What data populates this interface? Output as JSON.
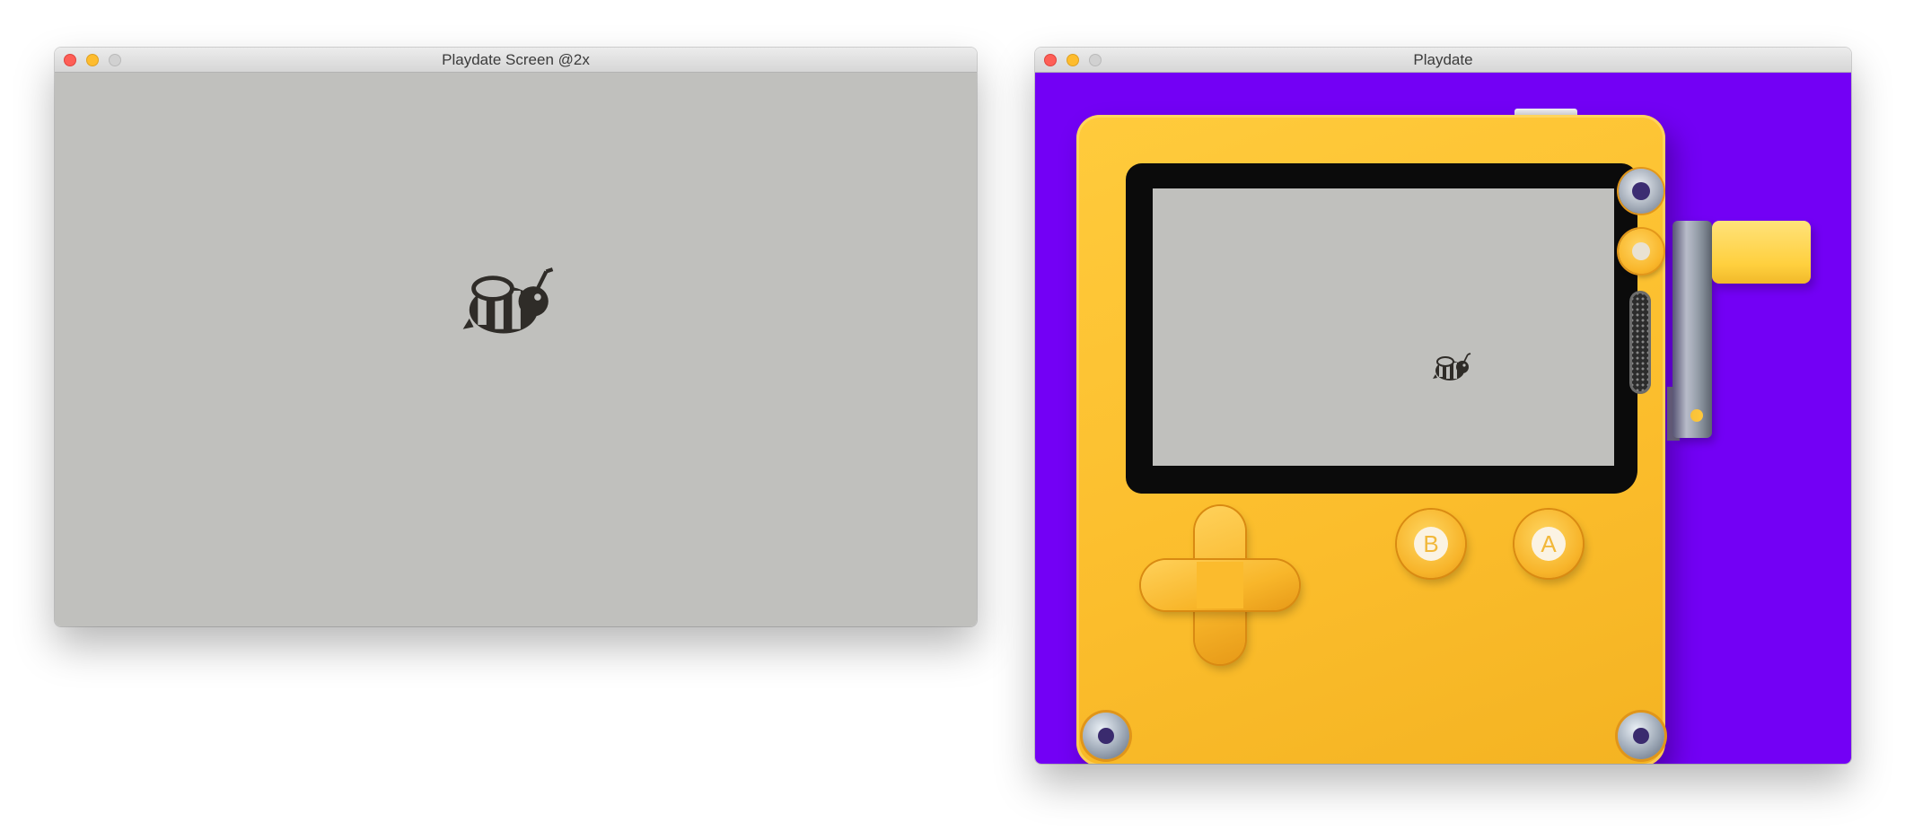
{
  "windows": [
    {
      "title": "Playdate Screen @2x",
      "screen_color": "#c0c0bd",
      "sprite": "bee-sprite"
    },
    {
      "title": "Playdate",
      "background_color": "#7300f5",
      "device_color": "#fbbd2c",
      "buttons": {
        "b_label": "B",
        "a_label": "A"
      }
    }
  ],
  "icons": [
    "close-icon",
    "minimize-icon",
    "zoom-icon",
    "bee-icon"
  ]
}
